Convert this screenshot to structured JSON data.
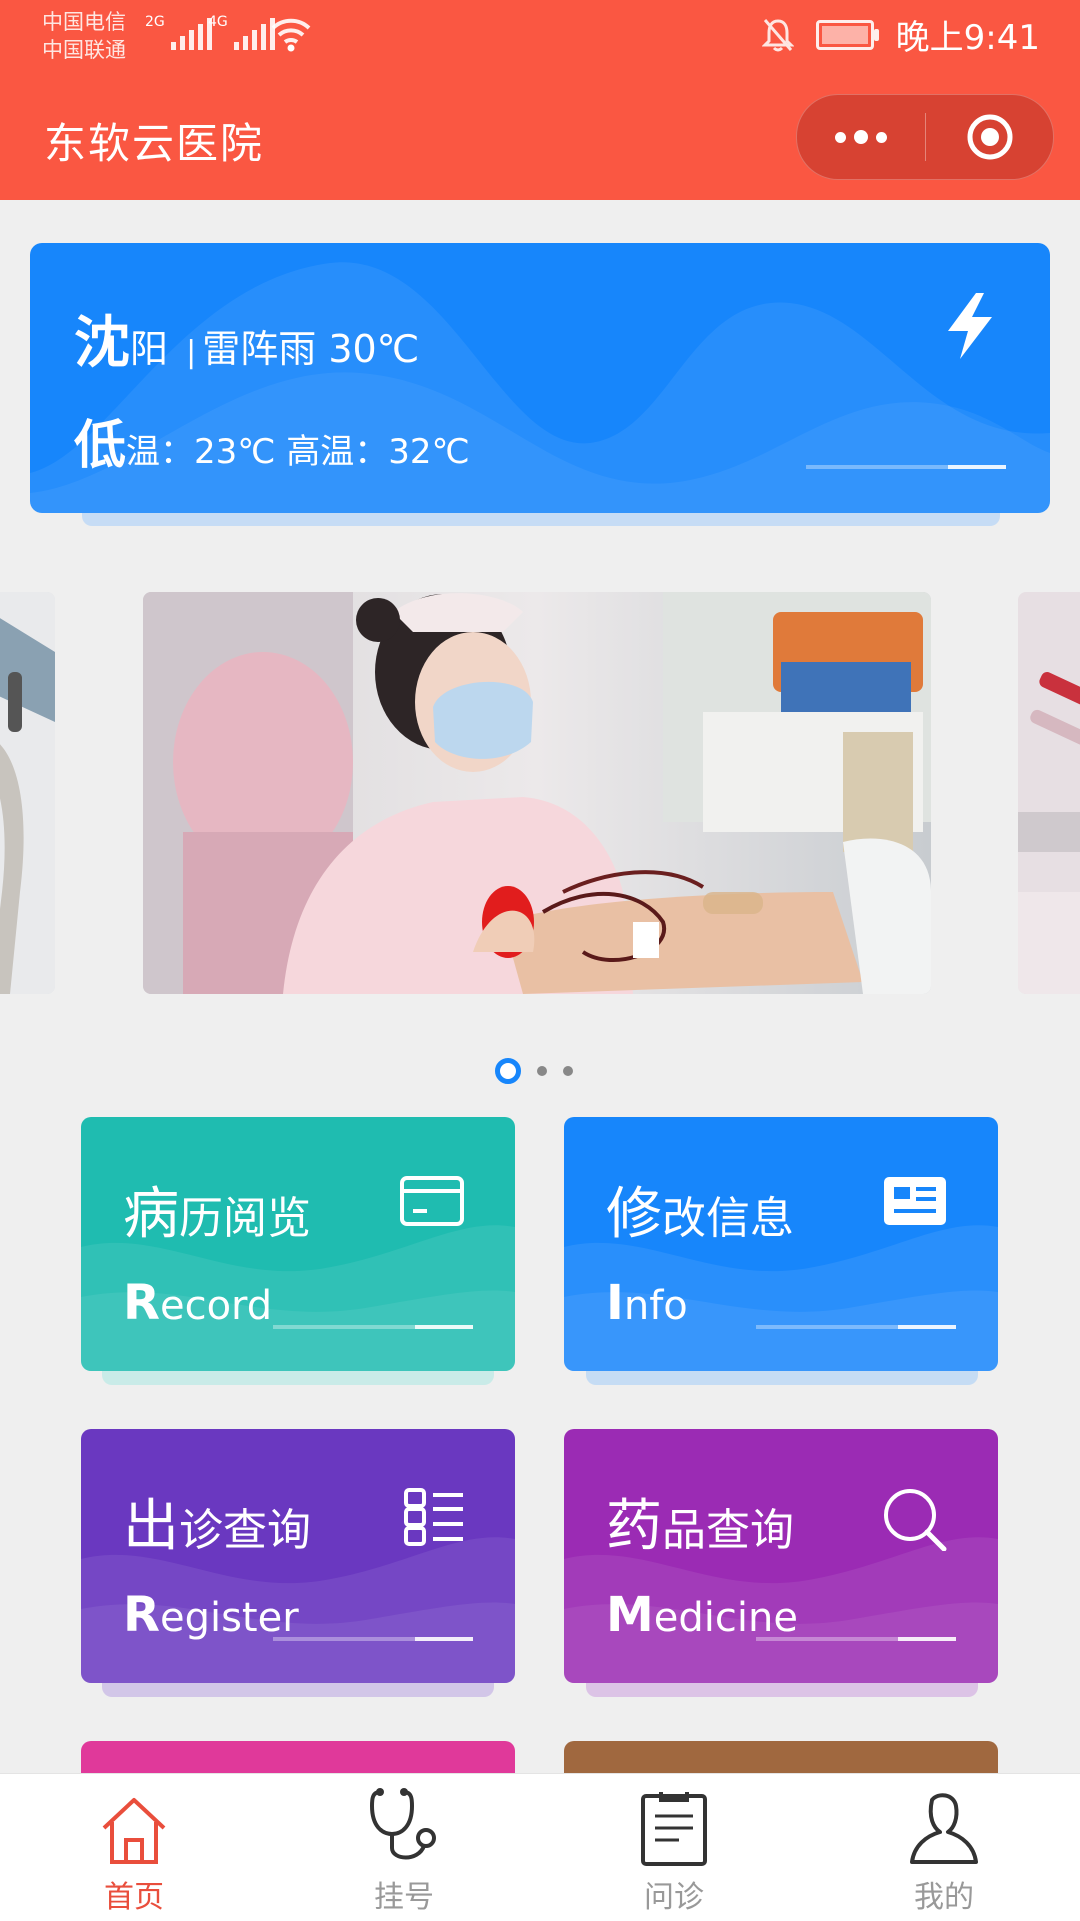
{
  "status_bar": {
    "carrier_1": "中国电信",
    "carrier_2": "中国联通",
    "signal_1_label": "2G",
    "signal_2_label": "4G",
    "time": "晚上9:41"
  },
  "header": {
    "title": "东软云医院"
  },
  "weather": {
    "city_first": "沈",
    "city_rest": "阳",
    "divider": "|",
    "condition": "雷阵雨",
    "temperature": "30℃",
    "low_first": "低",
    "low_rest": "温：23℃ 高温：32℃",
    "icon": "lightning-icon"
  },
  "carousel": {
    "slide_count": 3,
    "active_index": 0
  },
  "tiles": [
    {
      "title_first": "病",
      "title_rest": "历阅览",
      "sub_first": "R",
      "sub_rest": "ecord",
      "color": "#1fbcb0",
      "icon": "card-icon"
    },
    {
      "title_first": "修",
      "title_rest": "改信息",
      "sub_first": "I",
      "sub_rest": "nfo",
      "color": "#1786fb",
      "icon": "id-card-icon"
    },
    {
      "title_first": "出",
      "title_rest": "诊查询",
      "sub_first": "R",
      "sub_rest": "egister",
      "color": "#6a38c0",
      "icon": "list-icon"
    },
    {
      "title_first": "药",
      "title_rest": "品查询",
      "sub_first": "M",
      "sub_rest": "edicine",
      "color": "#9b2bb4",
      "icon": "search-icon"
    }
  ],
  "partial_tiles": [
    {
      "color": "#e0399a"
    },
    {
      "color": "#a0683f"
    }
  ],
  "tabbar": {
    "items": [
      {
        "label": "首页",
        "icon": "home-icon",
        "active": true
      },
      {
        "label": "挂号",
        "icon": "stethoscope-icon",
        "active": false
      },
      {
        "label": "问诊",
        "icon": "clipboard-icon",
        "active": false
      },
      {
        "label": "我的",
        "icon": "user-icon",
        "active": false
      }
    ]
  },
  "colors": {
    "header": "#fa5742",
    "accent": "#1786fb",
    "tab_active": "#e94e3c"
  }
}
